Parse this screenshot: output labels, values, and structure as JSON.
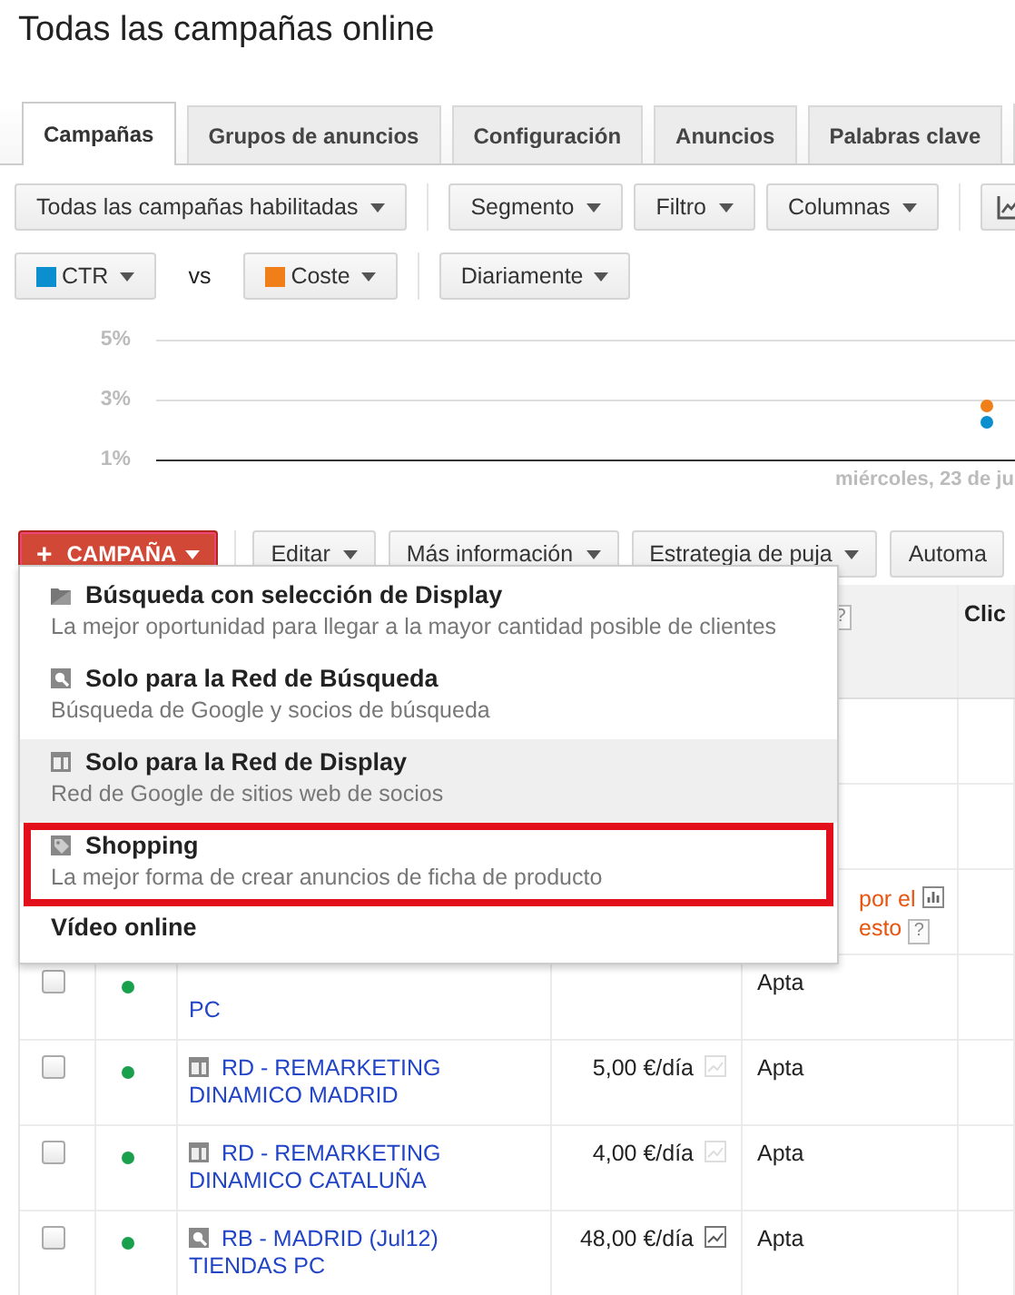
{
  "title": "Todas las campañas online",
  "tabs": [
    {
      "label": "Campañas",
      "selected": true
    },
    {
      "label": "Grupos de anuncios",
      "selected": false
    },
    {
      "label": "Configuración",
      "selected": false
    },
    {
      "label": "Anuncios",
      "selected": false
    },
    {
      "label": "Palabras clave",
      "selected": false
    }
  ],
  "filter_bar": [
    {
      "label": "Todas las campañas habilitadas"
    },
    {
      "label": "Segmento"
    },
    {
      "label": "Filtro"
    },
    {
      "label": "Columnas"
    }
  ],
  "metrics": {
    "first": {
      "label": "CTR",
      "color": "#0b8fce"
    },
    "joiner": "vs",
    "second": {
      "label": "Coste",
      "color": "#f07f1a"
    },
    "period": "Diariamente"
  },
  "graph": {
    "y_labels": [
      "5%",
      "3%",
      "1%"
    ],
    "date_label": "miércoles, 23 de ju"
  },
  "actions": {
    "new_campaign": {
      "icon": "+",
      "label": "CAMPAÑA"
    },
    "buttons": [
      "Editar",
      "Más información",
      "Estrategia de puja",
      "Automa"
    ]
  },
  "campaign_menu": [
    {
      "kind": "search-display",
      "title": "Búsqueda con selección de Display",
      "description": "La mejor oportunidad para llegar a la mayor cantidad posible de clientes",
      "hovered": false,
      "marked": false
    },
    {
      "kind": "search",
      "title": "Solo para la Red de Búsqueda",
      "description": "Búsqueda de Google y socios de búsqueda",
      "hovered": false,
      "marked": false
    },
    {
      "kind": "display",
      "title": "Solo para la Red de Display",
      "description": "Red de Google de sitios web de socios",
      "hovered": true,
      "marked": false
    },
    {
      "kind": "shopping",
      "title": "Shopping",
      "description": "La mejor forma de crear anuncios de ficha de producto",
      "hovered": false,
      "marked": true
    },
    {
      "kind": "video",
      "title": "Vídeo online",
      "hovered": false,
      "marked": false
    }
  ],
  "table": {
    "header": {
      "help_mark": "?",
      "column_6": "Clic"
    },
    "rows": [
      {
        "status_lines": [
          "por el",
          "esto"
        ],
        "help_mark": "?"
      },
      {
        "name": "PC",
        "name_cut": true,
        "status": "Apta",
        "checked": false
      },
      {
        "kind": "display",
        "name": "RD - REMARKETING DINAMICO MADRID",
        "budget": "5,00 €/día",
        "status": "Apta",
        "chart_active": false,
        "checked": false
      },
      {
        "kind": "display",
        "name": "RD - REMARKETING DINAMICO CATALUÑA",
        "budget": "4,00 €/día",
        "status": "Apta",
        "chart_active": false,
        "checked": false
      },
      {
        "kind": "search",
        "name": "RB - MADRID (Jul12) TIENDAS PC",
        "budget": "48,00 €/día",
        "status": "Apta",
        "chart_active": true,
        "checked": false
      }
    ]
  }
}
